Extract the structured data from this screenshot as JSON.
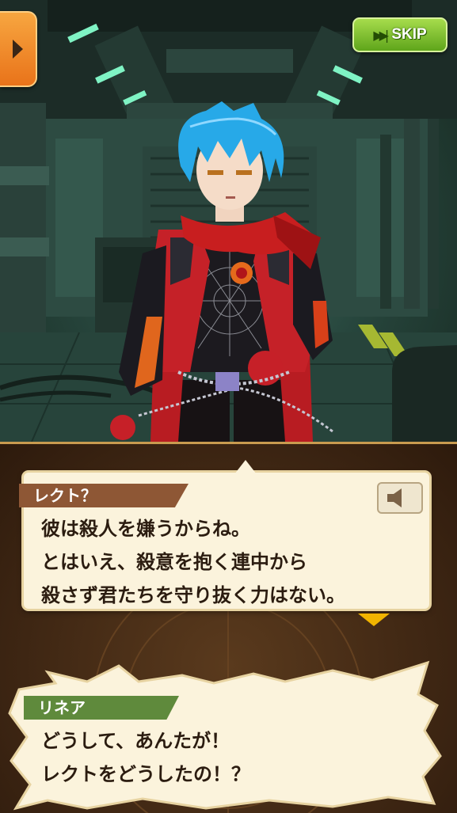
{
  "controls": {
    "skip_label": "SKIP",
    "skip_icon": "fast-forward-icon",
    "menu_icon": "play-arrow-icon"
  },
  "dialogue": {
    "current": {
      "speaker": "レクト？",
      "lines": [
        "彼は殺人を嫌うからね。",
        "とはいえ、殺意を抱く連中から",
        "殺さず君たちを守り抜く力はない。"
      ]
    },
    "reply": {
      "speaker": "リネア",
      "lines": [
        "どうして、あんたが！",
        "レクトをどうしたの！？"
      ]
    }
  },
  "colors": {
    "skip_green": "#7cc22e",
    "menu_orange": "#f08c2a",
    "speaker1_tag": "#8e5735",
    "speaker2_tag": "#5f8a3c",
    "next_indicator": "#f1b400"
  }
}
